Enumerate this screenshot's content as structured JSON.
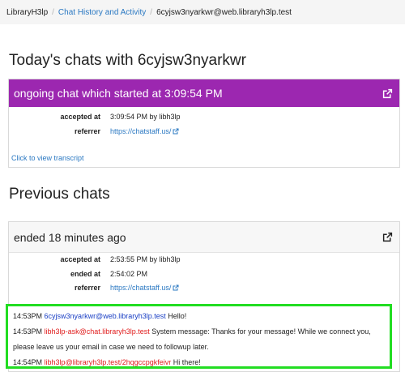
{
  "breadcrumb": {
    "home": "LibraryH3lp",
    "section": "Chat History and Activity",
    "current": "6cyjsw3nyarkwr@web.libraryh3lp.test"
  },
  "today": {
    "heading": "Today's chats with 6cyjsw3nyarkwr",
    "card_title": "ongoing chat which started at 3:09:54 PM",
    "accepted_label": "accepted at",
    "accepted_value": "3:09:54 PM by libh3lp",
    "referrer_label": "referrer",
    "referrer_value": "https://chatstaff.us/",
    "transcript_link": "Click to view transcript",
    "header_color": "#9c27b0"
  },
  "previous": {
    "heading": "Previous chats",
    "card_title": "ended 18 minutes ago",
    "accepted_label": "accepted at",
    "accepted_value": "2:53:55 PM by libh3lp",
    "ended_label": "ended at",
    "ended_value": "2:54:02 PM",
    "referrer_label": "referrer",
    "referrer_value": "https://chatstaff.us/"
  },
  "transcript": {
    "messages": [
      {
        "time": "14:53PM",
        "from": "6cyjsw3nyarkwr@web.libraryh3lp.test",
        "text": "Hello!"
      },
      {
        "time": "14:53PM",
        "from": "libh3lp-ask@chat.libraryh3lp.test",
        "text": "System message: Thanks for your message! While we connect you,"
      },
      {
        "text": "please leave us your email in case we need to followup later."
      },
      {
        "time": "14:54PM",
        "from": "libh3lp@libraryh3lp.test/2hqgccpgkfeivr",
        "text": "Hi there!"
      }
    ]
  },
  "icons": {
    "external_link": "external-link-icon"
  }
}
